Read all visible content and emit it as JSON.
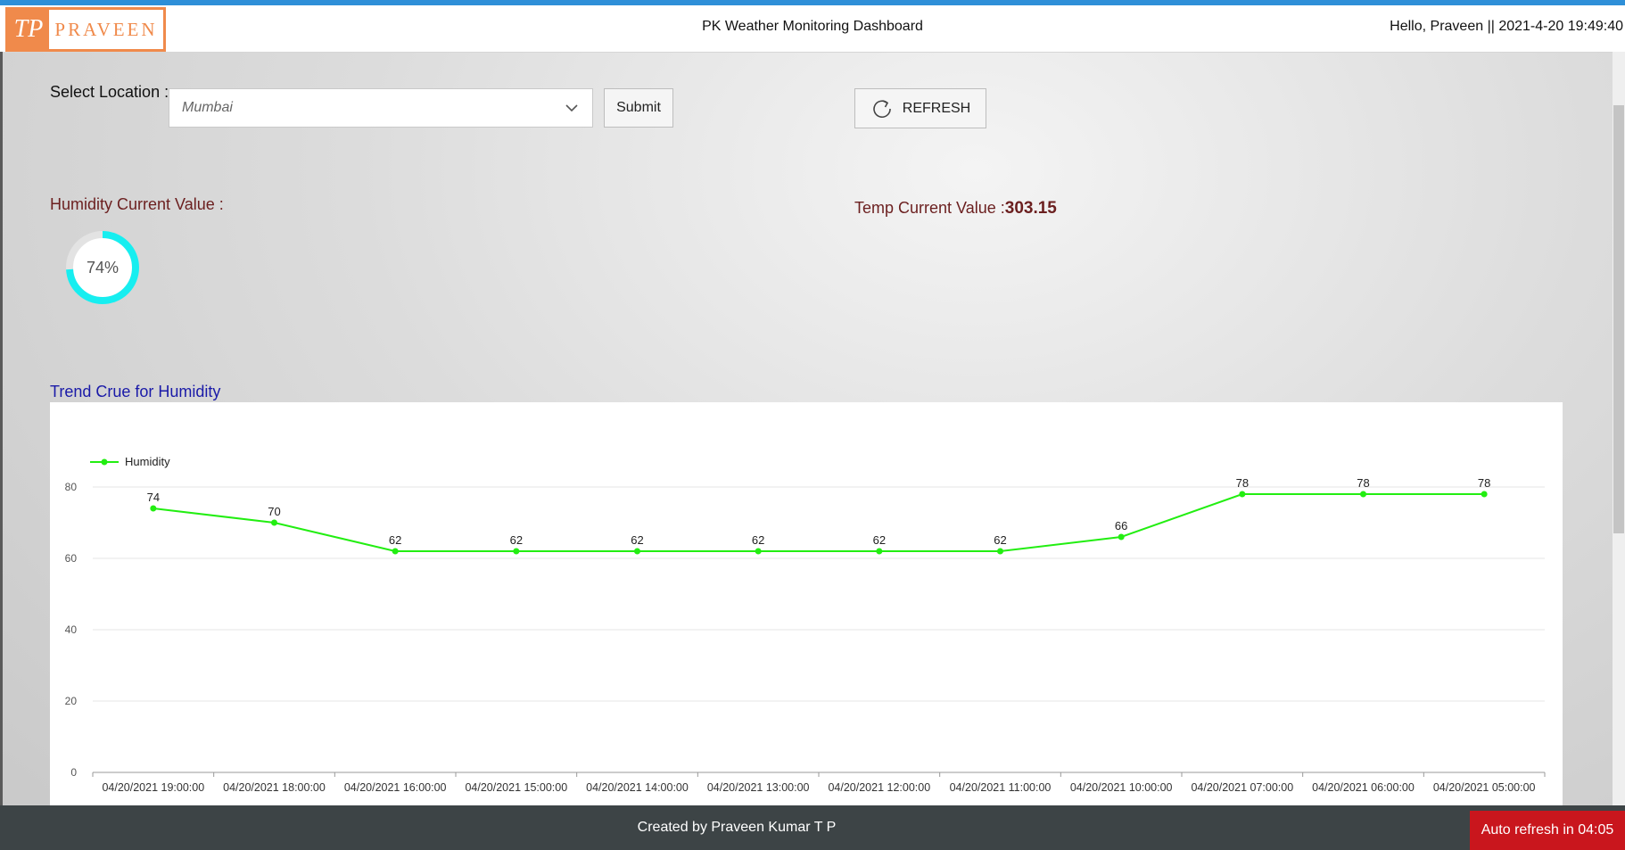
{
  "header": {
    "logo_mark": "TP",
    "logo_text": "PRAVEEN",
    "title": "PK Weather Monitoring Dashboard",
    "greeting": "Hello, Praveen || 2021-4-20 19:49:40"
  },
  "location": {
    "label": "Select Location :",
    "selected": "Mumbai",
    "submit_label": "Submit",
    "refresh_label": "REFRESH"
  },
  "humidity": {
    "label": "Humidity Current Value :",
    "value_text": "74%",
    "percent": 74,
    "color": "#17eef0"
  },
  "temperature": {
    "label": "Temp Current Value :",
    "value": "303.15"
  },
  "trend": {
    "title": "Trend Crue for Humidity"
  },
  "chart_data": {
    "type": "line",
    "categories": [
      "04/20/2021 19:00:00",
      "04/20/2021 18:00:00",
      "04/20/2021 16:00:00",
      "04/20/2021 15:00:00",
      "04/20/2021 14:00:00",
      "04/20/2021 13:00:00",
      "04/20/2021 12:00:00",
      "04/20/2021 11:00:00",
      "04/20/2021 10:00:00",
      "04/20/2021 07:00:00",
      "04/20/2021 06:00:00",
      "04/20/2021 05:00:00"
    ],
    "series": [
      {
        "name": "Humidity",
        "values": [
          74,
          70,
          62,
          62,
          62,
          62,
          62,
          62,
          66,
          78,
          78,
          78
        ],
        "color": "#22ee11"
      }
    ],
    "ylim": [
      0,
      80
    ],
    "yticks": [
      0,
      20,
      40,
      60,
      80
    ],
    "legend": "top-left",
    "grid": true,
    "data_labels": true
  },
  "footer": {
    "credit": "Created by Praveen Kumar T P",
    "auto_refresh": "Auto refresh in 04:05"
  }
}
